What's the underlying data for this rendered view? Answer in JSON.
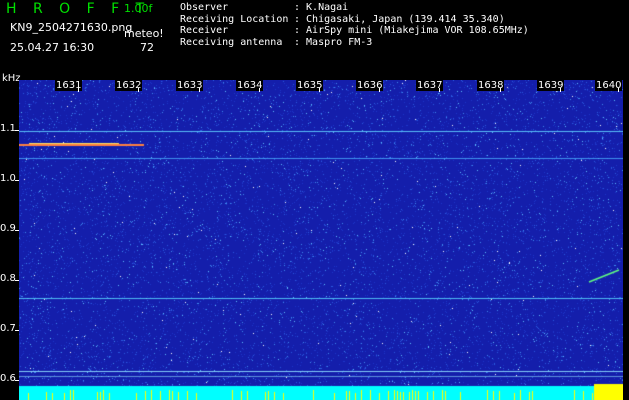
{
  "header": {
    "app_title": "H R O F F T",
    "version": "1.00f",
    "filename": "KN9_2504271630.png",
    "meteo_label": "meteo!",
    "datetime": "25.04.27 16:30",
    "count": "72"
  },
  "info": [
    {
      "label": "Observer",
      "value": ": K.Nagai"
    },
    {
      "label": "Receiving Location",
      "value": ": Chigasaki, Japan (139.414 35.340)"
    },
    {
      "label": "Receiver",
      "value": ": AirSpy mini (Miakejima VOR 108.65MHz)"
    },
    {
      "label": "Receiving antenna",
      "value": ": Maspro FM-3"
    }
  ],
  "axes": {
    "y_unit": "kHz",
    "y_ticks": [
      "1.1",
      "1.0",
      "0.9",
      "0.8",
      "0.7",
      "0.6"
    ],
    "x_ticks": [
      "1631",
      "1632",
      "1633",
      "1634",
      "1635",
      "1636",
      "1637",
      "1638",
      "1639",
      "1640"
    ]
  },
  "colors": {
    "background": "#141eab",
    "title_green": "#00e000",
    "baseline_cyan": "#00ffff",
    "burst_yellow": "#ffff00"
  }
}
